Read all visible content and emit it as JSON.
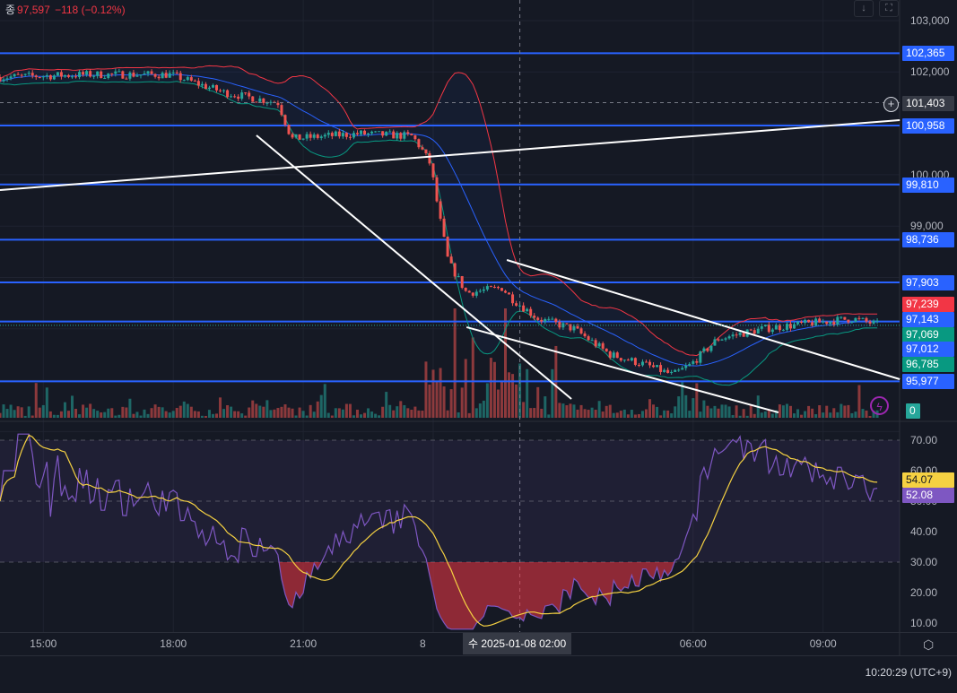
{
  "legend": {
    "prefix": "종",
    "close": "97,597",
    "change": "−118 (−0.12%)"
  },
  "toolbar": {
    "download_icon": "arrow-down-icon",
    "screenshot_icon": "fullscreen-icon"
  },
  "time_axis": {
    "ticks": [
      {
        "h": 15,
        "label": "15:00"
      },
      {
        "h": 18,
        "label": "18:00"
      },
      {
        "h": 21,
        "label": "21:00"
      },
      {
        "h": 24,
        "label": "8"
      },
      {
        "h": 30,
        "label": "06:00"
      },
      {
        "h": 33,
        "label": "09:00"
      }
    ],
    "crosshair_label": "수 2025-01-08   02:00",
    "clock": "10:20:29 (UTC+9)"
  },
  "price_axis": {
    "ticks": [
      {
        "p": 103000,
        "label": "103,000"
      },
      {
        "p": 102000,
        "label": "102,000"
      },
      {
        "p": 100000,
        "label": "100,000"
      },
      {
        "p": 99000,
        "label": "99,000"
      }
    ],
    "crosshair_label": "101,403",
    "volume_label": "0"
  },
  "colors": {
    "up": "#26a69a",
    "down": "#ef5350",
    "level": "#2962ff",
    "bb_upper": "#f23645",
    "bb_lower": "#089981",
    "bb_basis": "#2962ff",
    "rsi": "#7e57c2",
    "rsi_ma": "#f5d142",
    "bg": "#151924"
  },
  "chart_data": [
    {
      "type": "candlestick",
      "title": "BTC 5m",
      "x_unit": "hours since 2025-01-07 00:00 (24 = 2025-01-08 00:00)",
      "price_path": [
        [
          14.0,
          101900
        ],
        [
          16.07,
          101950
        ],
        [
          17.93,
          101950
        ],
        [
          19.18,
          101600
        ],
        [
          20.42,
          101400
        ],
        [
          20.73,
          100700
        ],
        [
          22.28,
          100800
        ],
        [
          23.52,
          100750
        ],
        [
          23.73,
          100500
        ],
        [
          23.94,
          100200
        ],
        [
          24.14,
          99200
        ],
        [
          24.35,
          98300
        ],
        [
          24.77,
          97700
        ],
        [
          25.59,
          97800
        ],
        [
          25.8,
          97600
        ],
        [
          26.42,
          97200
        ],
        [
          27.25,
          97000
        ],
        [
          28.08,
          96500
        ],
        [
          28.91,
          96300
        ],
        [
          29.53,
          96100
        ],
        [
          29.94,
          96300
        ],
        [
          30.56,
          96800
        ],
        [
          31.6,
          97000
        ],
        [
          32.63,
          97100
        ],
        [
          33.67,
          97200
        ],
        [
          34.33,
          97070
        ]
      ],
      "horizontal_levels": [
        102365,
        100958,
        99810,
        98736,
        97903,
        97143,
        95977
      ],
      "trendlines": [
        [
          [
            14.0,
            99702
          ],
          [
            34.77,
            101063
          ]
        ],
        [
          [
            19.92,
            100766
          ],
          [
            27.19,
            95635
          ]
        ],
        [
          [
            25.7,
            98340
          ],
          [
            34.77,
            96019
          ]
        ],
        [
          [
            24.77,
            97032
          ],
          [
            31.97,
            95373
          ]
        ]
      ],
      "price_labels": [
        {
          "label": "102,365",
          "p": 102365,
          "color": "#2962ff"
        },
        {
          "label": "100,958",
          "p": 100958,
          "color": "#2962ff"
        },
        {
          "label": "99,810",
          "p": 99810,
          "color": "#2962ff"
        },
        {
          "label": "98,736",
          "p": 98736,
          "color": "#2962ff"
        },
        {
          "label": "97,903",
          "p": 97903,
          "color": "#2962ff"
        },
        {
          "label": "97,239",
          "p": 97480,
          "color": "#f23645"
        },
        {
          "label": "97,143",
          "p": 97185,
          "color": "#2962ff"
        },
        {
          "label": "97,069",
          "p": 96895,
          "color": "#089981"
        },
        {
          "label": "97,012",
          "p": 96605,
          "color": "#2962ff"
        },
        {
          "label": "96,785",
          "p": 96315,
          "color": "#089981"
        },
        {
          "label": "95,977",
          "p": 95977,
          "color": "#2962ff"
        }
      ],
      "crosshair": {
        "h": 26.0,
        "p": 101403
      },
      "indicators": [
        "Bollinger Bands (20, 2)",
        "Volume"
      ]
    },
    {
      "type": "line",
      "title": "RSI 14",
      "ylim": [
        5,
        75
      ],
      "yticks": [
        "70.00",
        "60.00",
        "50.00",
        "40.00",
        "30.00",
        "20.00",
        "10.00"
      ],
      "bands": [
        70,
        50,
        30
      ],
      "rsi_value": "52.08",
      "ma_value": "54.07"
    }
  ]
}
